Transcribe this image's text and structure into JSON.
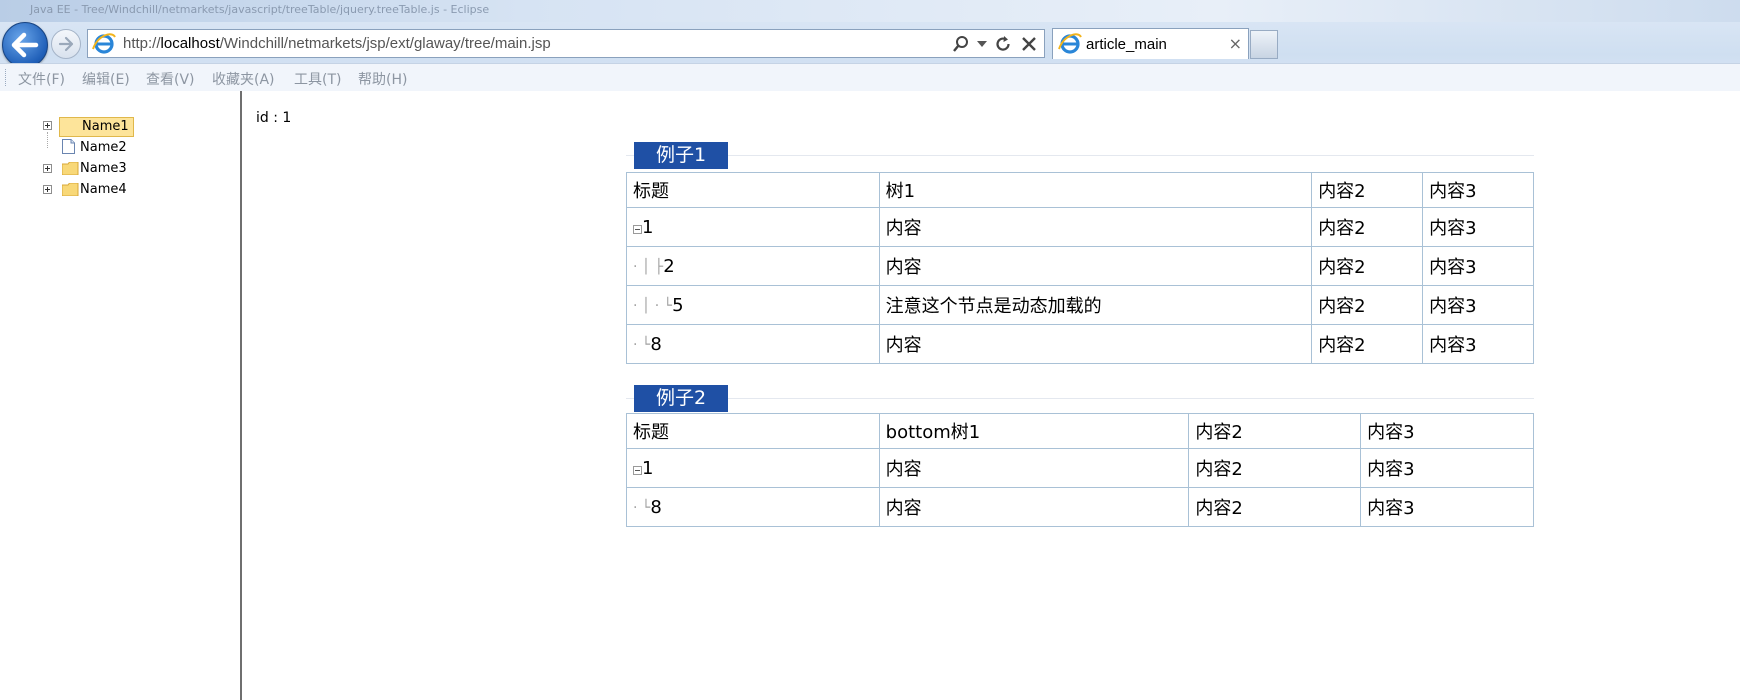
{
  "browser": {
    "title_text": "Java  EE - Tree/Windchill/netmarkets/javascript/treeTable/jquery.treeTable.js - Eclipse",
    "url_prefix": "http://",
    "url_host": "localhost",
    "url_path": "/Windchill/netmarkets/jsp/ext/glaway/tree/main.jsp",
    "tab_title": "article_main",
    "tab_close": "×",
    "menu": [
      "文件(F)",
      "编辑(E)",
      "查看(V)",
      "收藏夹(A)",
      "工具(T)",
      "帮助(H)"
    ]
  },
  "tree": {
    "nodes": [
      {
        "label": "Name1",
        "selected": true,
        "type": "folder",
        "expandable": true
      },
      {
        "label": "Name2",
        "selected": false,
        "type": "file",
        "expandable": false
      },
      {
        "label": "Name3",
        "selected": false,
        "type": "folder",
        "expandable": true
      },
      {
        "label": "Name4",
        "selected": false,
        "type": "folder",
        "expandable": true
      }
    ]
  },
  "content": {
    "id_label": "id : 1",
    "examples": [
      {
        "title": "例子1",
        "headers": [
          "标题",
          "树1",
          "内容2",
          "内容3"
        ],
        "rows": [
          {
            "node": "1",
            "cols": [
              "内容",
              "内容2",
              "内容3"
            ]
          },
          {
            "node": "2",
            "cols": [
              "内容",
              "内容2",
              "内容3"
            ]
          },
          {
            "node": "5",
            "cols": [
              "注意这个节点是动态加载的",
              "内容2",
              "内容3"
            ]
          },
          {
            "node": "8",
            "cols": [
              "内容",
              "内容2",
              "内容3"
            ]
          }
        ]
      },
      {
        "title": "例子2",
        "headers": [
          "标题",
          "bottom树1",
          "内容2",
          "内容3"
        ],
        "rows": [
          {
            "node": "1",
            "cols": [
              "内容",
              "内容2",
              "内容3"
            ]
          },
          {
            "node": "8",
            "cols": [
              "内容",
              "内容2",
              "内容3"
            ]
          }
        ]
      }
    ]
  },
  "colors": {
    "example_title_bg": "#1f50a5",
    "selected_node_bg": "#fde49a",
    "table_border": "#a9c1d6"
  }
}
